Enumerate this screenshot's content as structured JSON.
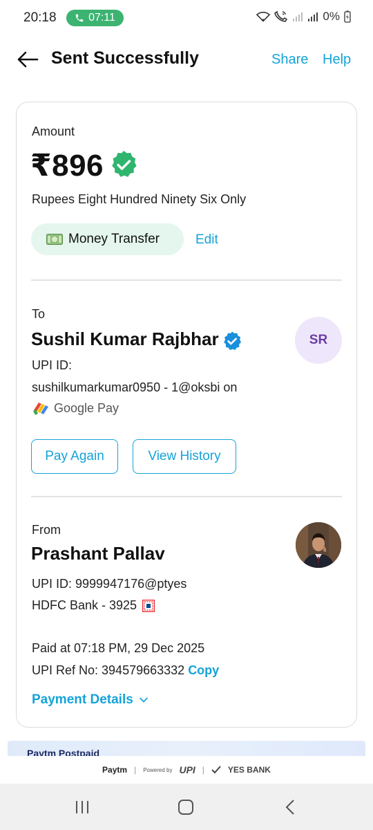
{
  "status_bar": {
    "time": "20:18",
    "call_duration": "07:11",
    "battery": "0%",
    "icons": [
      "phone-icon",
      "wifi-icon",
      "wifi-calling-icon",
      "signal-icon",
      "battery-icon"
    ]
  },
  "header": {
    "title": "Sent Successfully",
    "share_label": "Share",
    "help_label": "Help",
    "back_icon": "arrow-left-icon"
  },
  "amount": {
    "label": "Amount",
    "value": "₹896",
    "in_words": "Rupees Eight Hundred Ninety Six Only",
    "tag_label": "Money Transfer",
    "tag_icon": "money-icon",
    "edit_label": "Edit"
  },
  "to": {
    "label": "To",
    "name": "Sushil Kumar Rajbhar",
    "avatar_initials": "SR",
    "upi_label": "UPI ID:",
    "upi_id": "sushilkumarkumar0950 - 1@oksbi on",
    "app_name": "Google Pay",
    "pay_again_label": "Pay Again",
    "view_history_label": "View History"
  },
  "from": {
    "label": "From",
    "name": "Prashant Pallav",
    "upi_id": "UPI ID: 9999947176@ptyes",
    "bank": "HDFC Bank - 3925",
    "paid_at": "Paid at 07:18 PM, 29 Dec 2025",
    "ref_label": "UPI Ref No: 394579663332",
    "copy_label": "Copy",
    "details_label": "Payment Details"
  },
  "promo": {
    "text": "Paytm Postpaid"
  },
  "footer": {
    "paytm": "Paytm",
    "powered_by": "Powered by",
    "upi": "UPI",
    "yes_bank": "YES BANK"
  },
  "colors": {
    "accent": "#14a3d8",
    "success": "#2fb56e",
    "chip_bg": "#e5f6ee",
    "avatar_bg": "#eee6fb"
  }
}
